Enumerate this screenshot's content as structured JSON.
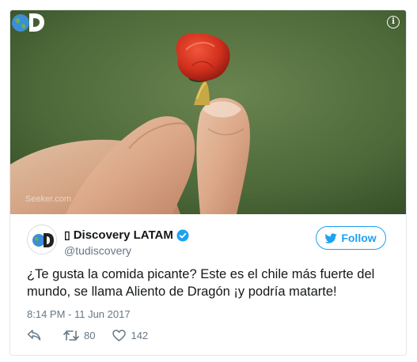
{
  "media": {
    "watermark": "Seeker.com",
    "info_icon": "info-icon",
    "logo_icon": "discovery-logo-icon"
  },
  "author": {
    "prefix_glyph": "▯",
    "display_name": "Discovery LATAM",
    "handle": "@tudiscovery",
    "verified_icon": "verified-badge-icon"
  },
  "follow_button": {
    "label": "Follow",
    "icon": "twitter-bird-icon"
  },
  "tweet": {
    "text": "¿Te gusta la comida picante? Este es el chile más fuerte del mundo, se llama Aliento de Dragón ¡y podría matarte!",
    "timestamp": "8:14 PM - 11 Jun 2017"
  },
  "actions": {
    "reply_icon": "reply-icon",
    "retweet_icon": "retweet-icon",
    "retweet_count": "80",
    "like_icon": "heart-icon",
    "like_count": "142"
  },
  "colors": {
    "accent": "#1da1f2",
    "text": "#14171a",
    "muted": "#657786",
    "border": "#e1e8ed"
  }
}
